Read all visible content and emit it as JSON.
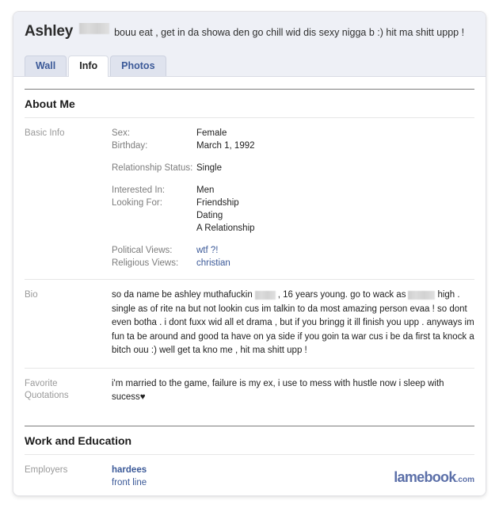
{
  "profile": {
    "first_name": "Ashley",
    "last_name_redacted": true,
    "status_text": "bouu eat , get in da showa den go chill wid dis sexy nigga b :) hit ma shitt uppp !",
    "tabs": [
      {
        "label": "Wall",
        "active": false
      },
      {
        "label": "Info",
        "active": true
      },
      {
        "label": "Photos",
        "active": false
      }
    ]
  },
  "sections": {
    "about_me": {
      "title": "About Me",
      "basic_info": {
        "label": "Basic Info",
        "groups": [
          {
            "fields": [
              {
                "key": "Sex:",
                "value": "Female"
              },
              {
                "key": "Birthday:",
                "value": "March 1, 1992"
              }
            ]
          },
          {
            "fields": [
              {
                "key": "Relationship Status:",
                "value": "Single"
              }
            ]
          },
          {
            "fields": [
              {
                "key": "Interested In:",
                "value": "Men"
              },
              {
                "key": "Looking For:",
                "value": "Friendship"
              }
            ],
            "extra_values": [
              "Dating",
              "A Relationship"
            ]
          },
          {
            "fields": [
              {
                "key": "Political Views:",
                "value": "wtf ?!",
                "is_link": true
              },
              {
                "key": "Religious Views:",
                "value": "christian",
                "is_link": true
              }
            ]
          }
        ]
      },
      "bio": {
        "label": "Bio",
        "text_part_1": "so da name be ashley muthafuckin",
        "text_part_2": ", 16 years young. go to wack as",
        "text_part_3": "high . single as of rite na but not lookin cus im talkin to da most amazing person evaa ! so dont even botha . i dont fuxx wid all et drama , but if you bringg it ill finish you upp . anyways im fun ta be around and good ta have on ya side if you goin ta war cus i be da first ta knock a bitch ouu :) well get ta kno me , hit ma shitt upp !"
      },
      "favorite_quotations": {
        "label_line_1": "Favorite",
        "label_line_2": "Quotations",
        "text": "i'm married to the game, failure is my ex, i use to mess with hustle now i sleep with sucess",
        "heart_glyph": "♥"
      }
    },
    "work_education": {
      "title": "Work and Education",
      "employers": {
        "label": "Employers",
        "primary": "hardees",
        "secondary": "front line"
      }
    }
  },
  "watermark": {
    "name": "lamebook",
    "tld": ".com"
  },
  "colors": {
    "link": "#3b5998",
    "header_band": "#eef0f6",
    "tab_inactive": "#dfe3ee",
    "label_gray": "#9a9a9a",
    "watermark": "#5b6fa8"
  }
}
